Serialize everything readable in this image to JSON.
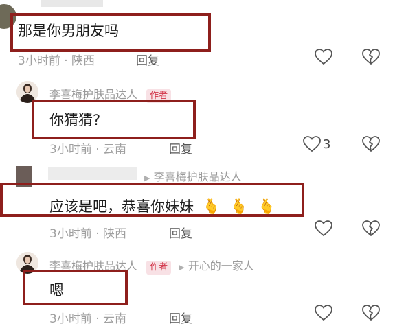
{
  "comments": [
    {
      "text": "那是你男朋友吗",
      "meta": "3小时前 · 陕西",
      "reply": "回复"
    },
    {
      "author": "李喜梅护肤品达人",
      "badge": "作者",
      "text": "你猜猜?",
      "meta": "3小时前 · 云南",
      "reply": "回复",
      "likes": "3"
    },
    {
      "reply_to": "李喜梅护肤品达人",
      "text": "应该是吧，恭喜你妹妹",
      "emoji": "🫰🫰🫰",
      "meta": "3小时前 · 陕西",
      "reply": "回复"
    },
    {
      "author": "李喜梅护肤品达人",
      "badge": "作者",
      "reply_to": "开心的一家人",
      "text": "嗯",
      "meta": "3小时前 · 云南",
      "reply": "回复"
    }
  ],
  "colors": {
    "highlight_box": "#8e1f1c",
    "author_badge_bg": "#f8e1e5",
    "author_badge_text": "#d2354a"
  }
}
